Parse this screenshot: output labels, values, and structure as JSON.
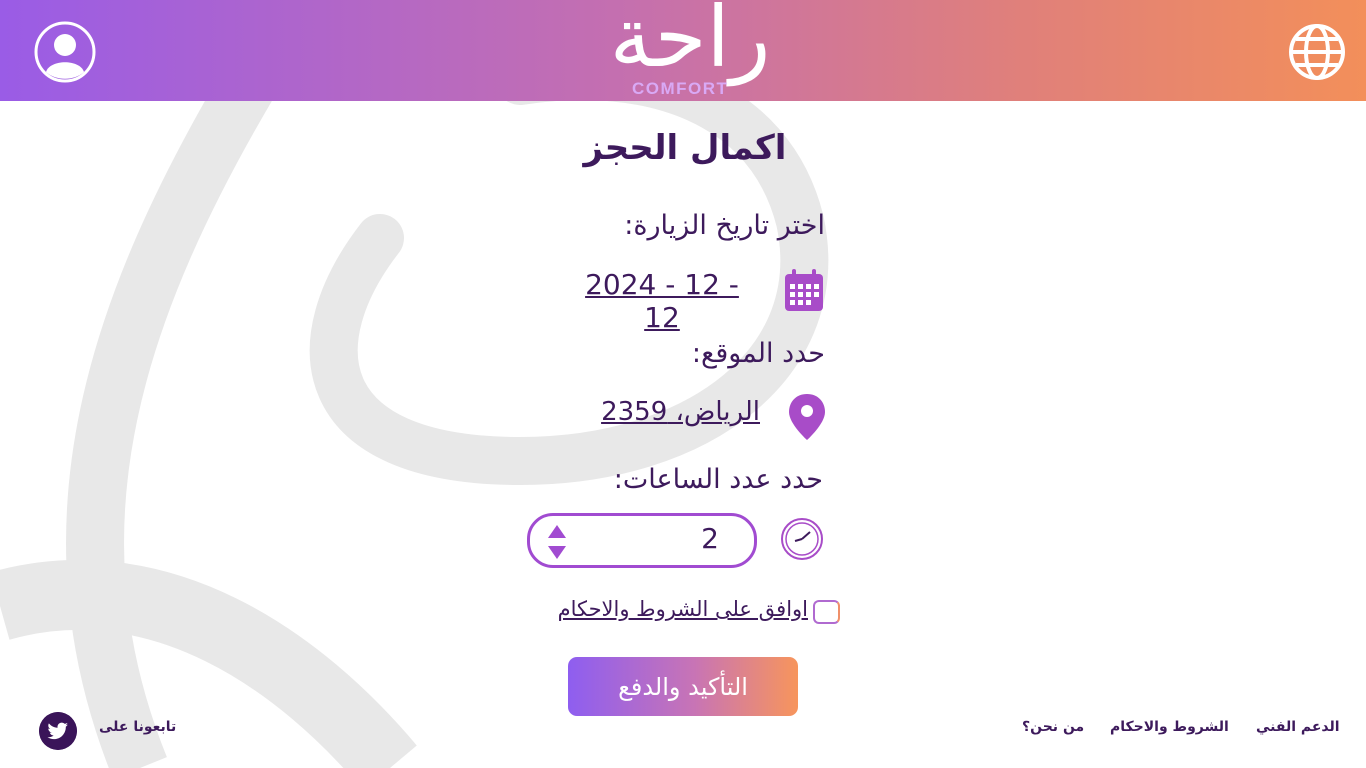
{
  "header": {
    "logo_ar": "راحة",
    "logo_en": "COMFORT",
    "profile_icon": "user-icon",
    "language_icon": "globe-icon"
  },
  "booking": {
    "title": "اكمال الحجز",
    "date_label": "اختر تاريخ الزيارة:",
    "date_value": "2024 - 12 - 12",
    "location_label": "حدد الموقع:",
    "location_value": "الرياض، 2359",
    "hours_label": "حدد عدد الساعات:",
    "hours_value": "2",
    "agree_text": "اوافق على الشروط والاحكام",
    "confirm_label": "التأكيد والدفع"
  },
  "footer": {
    "support": "الدعم الفني",
    "terms": "الشروط والاحكام",
    "about": "من نحن؟",
    "follow_us": "تابعونا على"
  },
  "colors": {
    "primary_dark": "#3d1a5c",
    "accent_purple": "#a14bd1",
    "gradient_start": "#9a5ce6",
    "gradient_end": "#f38f5a"
  }
}
